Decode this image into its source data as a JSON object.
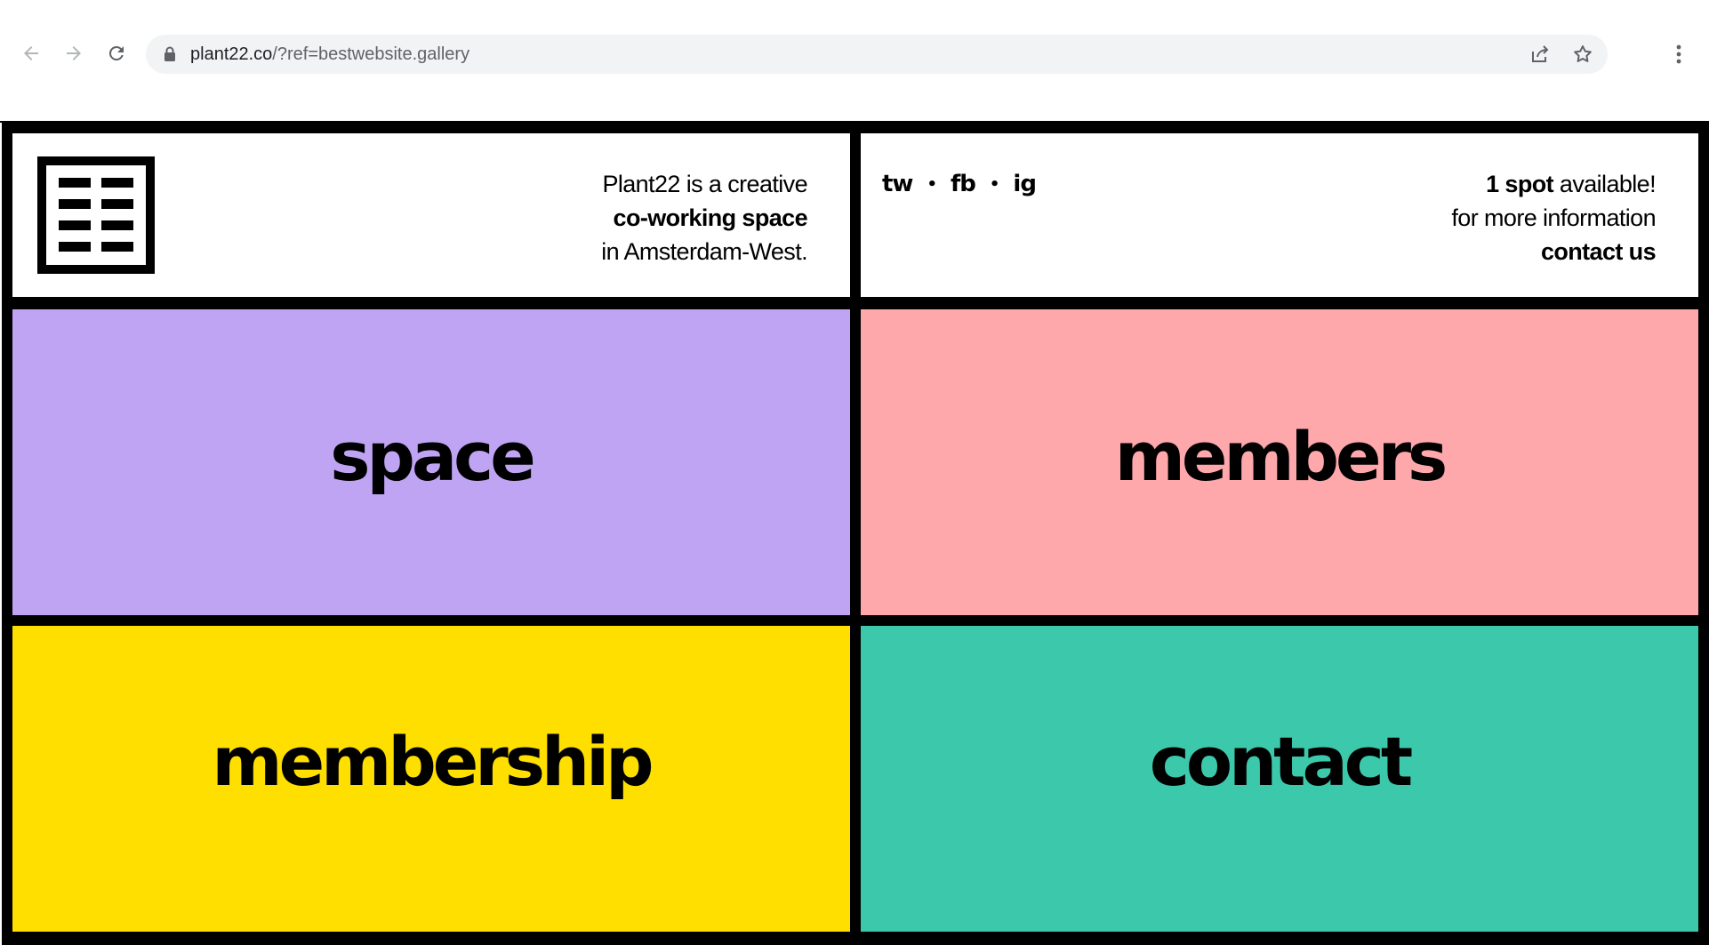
{
  "browser": {
    "url_host": "plant22.co",
    "url_path": "/?ref=bestwebsite.gallery",
    "back_icon": "arrow-left-icon",
    "forward_icon": "arrow-right-icon",
    "reload_icon": "reload-icon",
    "lock_icon": "lock-icon",
    "share_icon": "share-icon",
    "bookmark_icon": "star-icon",
    "menu_icon": "kebab-menu-icon"
  },
  "header": {
    "tagline_line1": "Plant22 is a creative",
    "tagline_line2": "co-working space",
    "tagline_line3": "in Amsterdam-West.",
    "socials": [
      {
        "label": "tw"
      },
      {
        "label": "fb"
      },
      {
        "label": "ig"
      }
    ],
    "social_separator": "•",
    "availability_strong": "1 spot",
    "availability_rest": " available!",
    "availability_line2": "for more information",
    "availability_link": "contact us"
  },
  "tiles": [
    {
      "label": "space",
      "color": "#c0a4f4"
    },
    {
      "label": "members",
      "color": "#ffa8ac"
    },
    {
      "label": "membership",
      "color": "#ffdf00"
    },
    {
      "label": "contact",
      "color": "#3cc8aa"
    }
  ],
  "colors": {
    "frame": "#000000",
    "omnibox": "#f1f3f4"
  }
}
